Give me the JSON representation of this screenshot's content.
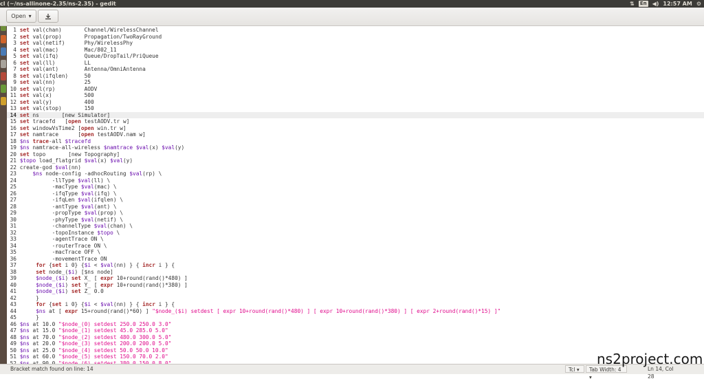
{
  "window": {
    "title": "cl (~/ns-allinone-2.35/ns-2.35) - gedit",
    "tray_lang": "En",
    "time": "12:57 AM"
  },
  "toolbar": {
    "open_label": "Open",
    "icons": [
      "chevron-down-icon",
      "save-icon"
    ]
  },
  "editor": {
    "lines": [
      {
        "n": "1",
        "parts": [
          {
            "t": "set",
            "c": "kw"
          },
          {
            "t": " val(chan)       Channel/WirelessChannel"
          }
        ]
      },
      {
        "n": "2",
        "parts": [
          {
            "t": "set",
            "c": "kw"
          },
          {
            "t": " val(prop)       Propagation/TwoRayGround"
          }
        ]
      },
      {
        "n": "3",
        "parts": [
          {
            "t": "set",
            "c": "kw"
          },
          {
            "t": " val(netif)      Phy/WirelessPhy"
          }
        ]
      },
      {
        "n": "4",
        "parts": [
          {
            "t": "set",
            "c": "kw"
          },
          {
            "t": " val(mac)        Mac/802_11"
          }
        ]
      },
      {
        "n": "5",
        "parts": [
          {
            "t": "set",
            "c": "kw"
          },
          {
            "t": " val(ifq)        Queue/DropTail/PriQueue"
          }
        ]
      },
      {
        "n": "6",
        "parts": [
          {
            "t": "set",
            "c": "kw"
          },
          {
            "t": " val(ll)         LL"
          }
        ]
      },
      {
        "n": "7",
        "parts": [
          {
            "t": "set",
            "c": "kw"
          },
          {
            "t": " val(ant)        Antenna/OmniAntenna"
          }
        ]
      },
      {
        "n": "8",
        "parts": [
          {
            "t": "set",
            "c": "kw"
          },
          {
            "t": " val(ifqlen)     50"
          }
        ]
      },
      {
        "n": "9",
        "parts": [
          {
            "t": "set",
            "c": "kw"
          },
          {
            "t": " val(nn)         25"
          }
        ]
      },
      {
        "n": "10",
        "parts": [
          {
            "t": "set",
            "c": "kw"
          },
          {
            "t": " val(rp)         AODV"
          }
        ]
      },
      {
        "n": "11",
        "parts": [
          {
            "t": "set",
            "c": "kw"
          },
          {
            "t": " val(x)          500"
          }
        ]
      },
      {
        "n": "12",
        "parts": [
          {
            "t": "set",
            "c": "kw"
          },
          {
            "t": " val(y)          400"
          }
        ]
      },
      {
        "n": "13",
        "parts": [
          {
            "t": "set",
            "c": "kw"
          },
          {
            "t": " val(stop)       150"
          }
        ]
      },
      {
        "n": "14",
        "cur": true,
        "parts": [
          {
            "t": "set",
            "c": "kw"
          },
          {
            "t": " ns       [new Simulator]"
          }
        ]
      },
      {
        "n": "15",
        "parts": [
          {
            "t": "set",
            "c": "kw"
          },
          {
            "t": " tracefd   ["
          },
          {
            "t": "open",
            "c": "kw"
          },
          {
            "t": " testAODV.tr w]"
          }
        ]
      },
      {
        "n": "16",
        "parts": [
          {
            "t": "set",
            "c": "kw"
          },
          {
            "t": " windowVsTime2 ["
          },
          {
            "t": "open",
            "c": "kw"
          },
          {
            "t": " win.tr w]"
          }
        ]
      },
      {
        "n": "17",
        "parts": [
          {
            "t": "set",
            "c": "kw"
          },
          {
            "t": " namtrace      ["
          },
          {
            "t": "open",
            "c": "kw"
          },
          {
            "t": " testAODV.nam w]"
          }
        ]
      },
      {
        "n": "18",
        "parts": [
          {
            "t": "$ns",
            "c": "var"
          },
          {
            "t": " "
          },
          {
            "t": "trace",
            "c": "kw"
          },
          {
            "t": "-all "
          },
          {
            "t": "$tracefd",
            "c": "var"
          }
        ]
      },
      {
        "n": "19",
        "parts": [
          {
            "t": "$ns",
            "c": "var"
          },
          {
            "t": " namtrace-all-wireless "
          },
          {
            "t": "$namtrace",
            "c": "var"
          },
          {
            "t": " "
          },
          {
            "t": "$val",
            "c": "var"
          },
          {
            "t": "(x) "
          },
          {
            "t": "$val",
            "c": "var"
          },
          {
            "t": "(y)"
          }
        ]
      },
      {
        "n": "20",
        "parts": [
          {
            "t": "set",
            "c": "kw"
          },
          {
            "t": " topo       [new Topography]"
          }
        ]
      },
      {
        "n": "21",
        "parts": [
          {
            "t": "$topo",
            "c": "var"
          },
          {
            "t": " load_flatgrid "
          },
          {
            "t": "$val",
            "c": "var"
          },
          {
            "t": "(x) "
          },
          {
            "t": "$val",
            "c": "var"
          },
          {
            "t": "(y)"
          }
        ]
      },
      {
        "n": "22",
        "parts": [
          {
            "t": "create-god "
          },
          {
            "t": "$val",
            "c": "var"
          },
          {
            "t": "(nn)"
          }
        ]
      },
      {
        "n": "23",
        "parts": [
          {
            "t": "    "
          },
          {
            "t": "$ns",
            "c": "var"
          },
          {
            "t": " node-config -adhocRouting "
          },
          {
            "t": "$val",
            "c": "var"
          },
          {
            "t": "(rp) \\"
          }
        ]
      },
      {
        "n": "24",
        "parts": [
          {
            "t": "          -llType "
          },
          {
            "t": "$val",
            "c": "var"
          },
          {
            "t": "(ll) \\"
          }
        ]
      },
      {
        "n": "25",
        "parts": [
          {
            "t": "          -macType "
          },
          {
            "t": "$val",
            "c": "var"
          },
          {
            "t": "(mac) \\"
          }
        ]
      },
      {
        "n": "26",
        "parts": [
          {
            "t": "          -ifqType "
          },
          {
            "t": "$val",
            "c": "var"
          },
          {
            "t": "(ifq) \\"
          }
        ]
      },
      {
        "n": "27",
        "parts": [
          {
            "t": "          -ifqLen "
          },
          {
            "t": "$val",
            "c": "var"
          },
          {
            "t": "(ifqlen) \\"
          }
        ]
      },
      {
        "n": "28",
        "parts": [
          {
            "t": "          -antType "
          },
          {
            "t": "$val",
            "c": "var"
          },
          {
            "t": "(ant) \\"
          }
        ]
      },
      {
        "n": "29",
        "parts": [
          {
            "t": "          -propType "
          },
          {
            "t": "$val",
            "c": "var"
          },
          {
            "t": "(prop) \\"
          }
        ]
      },
      {
        "n": "30",
        "parts": [
          {
            "t": "          -phyType "
          },
          {
            "t": "$val",
            "c": "var"
          },
          {
            "t": "(netif) \\"
          }
        ]
      },
      {
        "n": "31",
        "parts": [
          {
            "t": "          -channelType "
          },
          {
            "t": "$val",
            "c": "var"
          },
          {
            "t": "(chan) \\"
          }
        ]
      },
      {
        "n": "32",
        "parts": [
          {
            "t": "          -topoInstance "
          },
          {
            "t": "$topo",
            "c": "var"
          },
          {
            "t": " \\"
          }
        ]
      },
      {
        "n": "33",
        "parts": [
          {
            "t": "          -agentTrace ON \\"
          }
        ]
      },
      {
        "n": "34",
        "parts": [
          {
            "t": "          -routerTrace ON \\"
          }
        ]
      },
      {
        "n": "35",
        "parts": [
          {
            "t": "          -macTrace OFF \\"
          }
        ]
      },
      {
        "n": "36",
        "parts": [
          {
            "t": "          -movementTrace ON"
          }
        ]
      },
      {
        "n": "37",
        "parts": [
          {
            "t": "     "
          },
          {
            "t": "for",
            "c": "kw"
          },
          {
            "t": " {"
          },
          {
            "t": "set",
            "c": "kw"
          },
          {
            "t": " i 0} {"
          },
          {
            "t": "$i",
            "c": "var"
          },
          {
            "t": " < "
          },
          {
            "t": "$val",
            "c": "var"
          },
          {
            "t": "(nn) } { "
          },
          {
            "t": "incr",
            "c": "kw"
          },
          {
            "t": " i } {"
          }
        ]
      },
      {
        "n": "38",
        "parts": [
          {
            "t": "     "
          },
          {
            "t": "set",
            "c": "kw"
          },
          {
            "t": " node_("
          },
          {
            "t": "$i",
            "c": "var"
          },
          {
            "t": ") [$ns node]"
          }
        ]
      },
      {
        "n": "39",
        "parts": [
          {
            "t": "     "
          },
          {
            "t": "$node_(",
            "c": "var"
          },
          {
            "t": "$i",
            "c": "var"
          },
          {
            "t": ") "
          },
          {
            "t": "set",
            "c": "kw"
          },
          {
            "t": " X_ [ "
          },
          {
            "t": "expr",
            "c": "kw"
          },
          {
            "t": " 10+round(rand()*480) ]"
          }
        ]
      },
      {
        "n": "40",
        "parts": [
          {
            "t": "     "
          },
          {
            "t": "$node_(",
            "c": "var"
          },
          {
            "t": "$i",
            "c": "var"
          },
          {
            "t": ") "
          },
          {
            "t": "set",
            "c": "kw"
          },
          {
            "t": " Y_ [ "
          },
          {
            "t": "expr",
            "c": "kw"
          },
          {
            "t": " 10+round(rand()*380) ]"
          }
        ]
      },
      {
        "n": "41",
        "parts": [
          {
            "t": "     "
          },
          {
            "t": "$node_(",
            "c": "var"
          },
          {
            "t": "$i",
            "c": "var"
          },
          {
            "t": ") "
          },
          {
            "t": "set",
            "c": "kw"
          },
          {
            "t": " Z_ 0.0"
          }
        ]
      },
      {
        "n": "42",
        "parts": [
          {
            "t": "     }"
          }
        ]
      },
      {
        "n": "43",
        "parts": [
          {
            "t": "     "
          },
          {
            "t": "for",
            "c": "kw"
          },
          {
            "t": " {"
          },
          {
            "t": "set",
            "c": "kw"
          },
          {
            "t": " i 0} {"
          },
          {
            "t": "$i",
            "c": "var"
          },
          {
            "t": " < "
          },
          {
            "t": "$val",
            "c": "var"
          },
          {
            "t": "(nn) } { "
          },
          {
            "t": "incr",
            "c": "kw"
          },
          {
            "t": " i } {"
          }
        ]
      },
      {
        "n": "44",
        "parts": [
          {
            "t": "     "
          },
          {
            "t": "$ns",
            "c": "var"
          },
          {
            "t": " at [ "
          },
          {
            "t": "expr",
            "c": "kw"
          },
          {
            "t": " 15+round(rand()*60) ] "
          },
          {
            "t": "\"$node_($i) setdest [ expr 10+round(rand()*480) ] [ expr 10+round(rand()*380) ] [ expr 2+round(rand()*15) ]\"",
            "c": "str"
          }
        ]
      },
      {
        "n": "45",
        "parts": [
          {
            "t": "     }"
          }
        ]
      },
      {
        "n": "46",
        "parts": [
          {
            "t": "$ns",
            "c": "var"
          },
          {
            "t": " at 10.0 "
          },
          {
            "t": "\"$node_(0) setdest 250.0 250.0 3.0\"",
            "c": "str"
          }
        ]
      },
      {
        "n": "47",
        "parts": [
          {
            "t": "$ns",
            "c": "var"
          },
          {
            "t": " at 15.0 "
          },
          {
            "t": "\"$node_(1) setdest 45.0 285.0 5.0\"",
            "c": "str"
          }
        ]
      },
      {
        "n": "48",
        "parts": [
          {
            "t": "$ns",
            "c": "var"
          },
          {
            "t": " at 70.0 "
          },
          {
            "t": "\"$node_(2) setdest 480.0 300.0 5.0\"",
            "c": "str"
          }
        ]
      },
      {
        "n": "49",
        "parts": [
          {
            "t": "$ns",
            "c": "var"
          },
          {
            "t": " at 20.0 "
          },
          {
            "t": "\"$node_(3) setdest 200.0 200.0 5.0\"",
            "c": "str"
          }
        ]
      },
      {
        "n": "50",
        "parts": [
          {
            "t": "$ns",
            "c": "var"
          },
          {
            "t": " at 25.0 "
          },
          {
            "t": "\"$node_(4) setdest 50.0 50.0 10.0\"",
            "c": "str"
          }
        ]
      },
      {
        "n": "51",
        "parts": [
          {
            "t": "$ns",
            "c": "var"
          },
          {
            "t": " at 60.0 "
          },
          {
            "t": "\"$node_(5) setdest 150.0 70.0 2.0\"",
            "c": "str"
          }
        ]
      },
      {
        "n": "52",
        "parts": [
          {
            "t": "$ns",
            "c": "var"
          },
          {
            "t": " at 90.0 "
          },
          {
            "t": "\"$node_(6) setdest 380.0 150.0 8.0\"",
            "c": "str"
          }
        ]
      }
    ]
  },
  "status": {
    "message": "Bracket match found on line: 14",
    "language": "Tcl",
    "tab_width": "Tab Width: 4",
    "position": "Ln 14, Col 28"
  },
  "watermark": "ns2project.com"
}
